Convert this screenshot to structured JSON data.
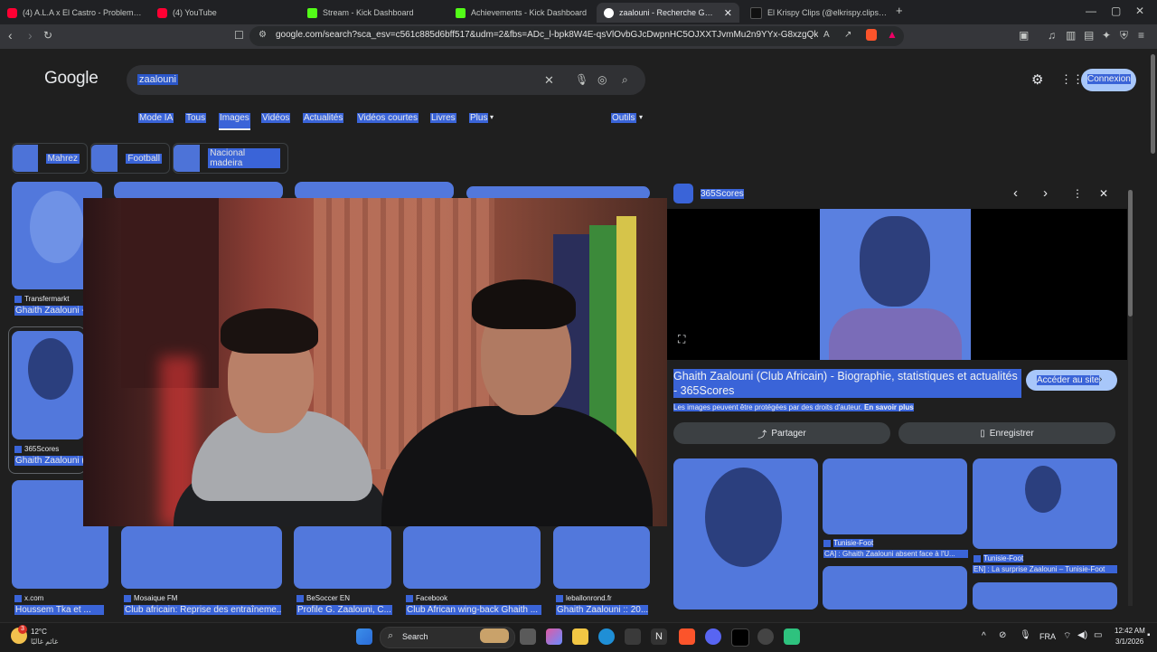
{
  "tabs": [
    {
      "title": "(4) A.L.A x El Castro - Problems - You",
      "icon": "youtube-icon"
    },
    {
      "title": "(4) YouTube",
      "icon": "youtube-icon"
    },
    {
      "title": "Stream - Kick Dashboard",
      "icon": "kick-icon"
    },
    {
      "title": "Achievements - Kick Dashboard",
      "icon": "kick-icon"
    },
    {
      "title": "zaalouni - Recherche Google",
      "icon": "google-icon"
    },
    {
      "title": "El Krispy Clips (@elkrispy.clips) | TikTo",
      "icon": "tiktok-icon"
    }
  ],
  "url": "google.com/search?sca_esv=c561c885d6bff517&udm=2&fbs=ADc_l-bpk8W4E-qsVlOvbGJcDwpnHC5OJXXTJvmMu2n9YYx-G8xzgQk24aW1N_F...",
  "google": {
    "logo": "Google",
    "query": "zaalouni",
    "signin": "Connexion",
    "nav": [
      "Mode IA",
      "Tous",
      "Images",
      "Vidéos",
      "Actualités",
      "Vidéos courtes",
      "Livres",
      "Plus"
    ],
    "tools": "Outils",
    "chips": [
      "Mahrez",
      "Football",
      "Nacional madeira"
    ]
  },
  "results_left": [
    {
      "source": "Transfermarkt",
      "title": "Ghaith Zaalouni -"
    },
    {
      "source": "365Scores",
      "title": "Ghaith Zaalouni (C"
    }
  ],
  "results_bottom": [
    {
      "source": "x.com",
      "title": "Houssem Tka et ..."
    },
    {
      "source": "Mosaique FM",
      "title": "Club africain: Reprise des entraîneme..."
    },
    {
      "source": "BeSoccer EN",
      "title": "Profile G. Zaalouni, C..."
    },
    {
      "source": "Facebook",
      "title": "Club African wing-back Ghaith ..."
    },
    {
      "source": "leballonrond.fr",
      "title": "Ghaith Zaalouni :: 20..."
    }
  ],
  "preview": {
    "source": "365Scores",
    "title": "Ghaith Zaalouni (Club Africain) - Biographie, statistiques et actualités - 365Scores",
    "visit": "Accéder au site",
    "copyright": "Les images peuvent être protégées par des droits d'auteur.",
    "learn_more": "En savoir plus",
    "share": "Partager",
    "save": "Enregistrer",
    "related": [
      {
        "source": "Tunisie-Foot",
        "title": "CA] : Ghaith Zaalouni absent face à l'U..."
      },
      {
        "source": "Tunisie-Foot",
        "title": "EN] : La surprise Zaalouni – Tunisie-Foot"
      }
    ]
  },
  "taskbar": {
    "weather_temp": "12°C",
    "weather_desc": "غائم غالبًا",
    "weather_badge": "3",
    "search": "Search",
    "lang": "FRA",
    "time": "12:42 AM",
    "date": "3/1/2026"
  },
  "colors": {
    "highlight": "#3a64d8",
    "image_tint": "#5278dc",
    "panel_bg": "#1f1f1f"
  }
}
